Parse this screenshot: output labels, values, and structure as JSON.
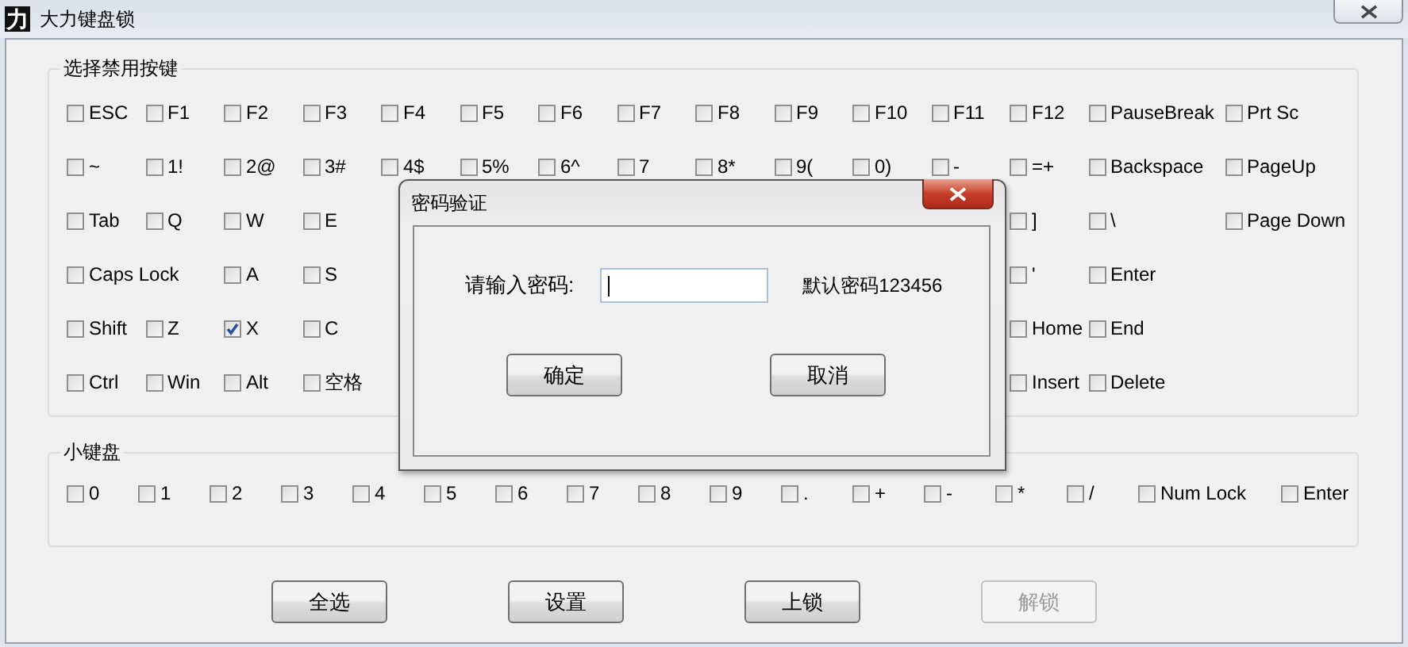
{
  "window": {
    "logo": "力",
    "title": "大力键盘锁"
  },
  "key_group": {
    "title": "选择禁用按键",
    "rows": [
      {
        "left": [
          {
            "label": "ESC",
            "checked": false
          },
          {
            "label": "F1",
            "checked": false
          },
          {
            "label": "F2",
            "checked": false
          },
          {
            "label": "F3",
            "checked": false
          },
          {
            "label": "F4",
            "checked": false
          },
          {
            "label": "F5",
            "checked": false
          },
          {
            "label": "F6",
            "checked": false
          },
          {
            "label": "F7",
            "checked": false
          },
          {
            "label": "F8",
            "checked": false
          },
          {
            "label": "F9",
            "checked": false
          },
          {
            "label": "F10",
            "checked": false
          },
          {
            "label": "F11",
            "checked": false
          },
          {
            "label": "F12",
            "checked": false
          },
          {
            "label": "PauseBreak",
            "checked": false
          }
        ],
        "right": [],
        "end": {
          "label": "Prt Sc",
          "checked": false
        }
      },
      {
        "left": [
          {
            "label": "~",
            "checked": false
          },
          {
            "label": "1!",
            "checked": false
          },
          {
            "label": "2@",
            "checked": false
          },
          {
            "label": "3#",
            "checked": false
          },
          {
            "label": "4$",
            "checked": false
          },
          {
            "label": "5%",
            "checked": false
          },
          {
            "label": "6^",
            "checked": false
          },
          {
            "label": "7",
            "checked": false
          },
          {
            "label": "8*",
            "checked": false
          },
          {
            "label": "9(",
            "checked": false
          },
          {
            "label": "0)",
            "checked": false
          },
          {
            "label": "-",
            "checked": false
          },
          {
            "label": "=+",
            "checked": false
          },
          {
            "label": "Backspace",
            "checked": false
          }
        ],
        "right": [],
        "end": {
          "label": "PageUp",
          "checked": false
        }
      },
      {
        "left": [
          {
            "label": "Tab",
            "checked": false
          },
          {
            "label": "Q",
            "checked": false
          },
          {
            "label": "W",
            "checked": false
          },
          {
            "label": "E",
            "checked": false
          }
        ],
        "right": [
          {
            "label": "]",
            "checked": false
          },
          {
            "label": "\\",
            "checked": false
          }
        ],
        "end": {
          "label": "Page Down",
          "checked": false
        }
      },
      {
        "left": [
          {
            "label": "Caps Lock",
            "checked": false
          },
          {
            "label": "A",
            "checked": false
          },
          {
            "label": "S",
            "checked": false
          }
        ],
        "right": [
          {
            "label": "'",
            "checked": false
          },
          {
            "label": "Enter",
            "checked": false
          }
        ]
      },
      {
        "left": [
          {
            "label": "Shift",
            "checked": false
          },
          {
            "label": "Z",
            "checked": false
          },
          {
            "label": "X",
            "checked": true
          },
          {
            "label": "C",
            "checked": false
          }
        ],
        "right": [
          {
            "label": "Home",
            "checked": false
          },
          {
            "label": "End",
            "checked": false
          }
        ]
      },
      {
        "left": [
          {
            "label": "Ctrl",
            "checked": false
          },
          {
            "label": "Win",
            "checked": false
          },
          {
            "label": "Alt",
            "checked": false
          },
          {
            "label": "空格",
            "checked": false
          }
        ],
        "right": [
          {
            "label": "Insert",
            "checked": false
          },
          {
            "label": "Delete",
            "checked": false
          }
        ]
      }
    ]
  },
  "numpad_group": {
    "title": "小键盘",
    "keys": [
      {
        "label": "0",
        "checked": false
      },
      {
        "label": "1",
        "checked": false
      },
      {
        "label": "2",
        "checked": false
      },
      {
        "label": "3",
        "checked": false
      },
      {
        "label": "4",
        "checked": false
      },
      {
        "label": "5",
        "checked": false
      },
      {
        "label": "6",
        "checked": false
      },
      {
        "label": "7",
        "checked": false
      },
      {
        "label": "8",
        "checked": false
      },
      {
        "label": "9",
        "checked": false
      },
      {
        "label": ".",
        "checked": false
      },
      {
        "label": "+",
        "checked": false
      },
      {
        "label": "-",
        "checked": false
      },
      {
        "label": "*",
        "checked": false
      },
      {
        "label": "/",
        "checked": false
      },
      {
        "label": "Num Lock",
        "checked": false
      },
      {
        "label": "Enter",
        "checked": false
      }
    ]
  },
  "buttons": [
    {
      "label": "全选",
      "disabled": false
    },
    {
      "label": "设置",
      "disabled": false
    },
    {
      "label": "上锁",
      "disabled": false
    },
    {
      "label": "解锁",
      "disabled": true
    }
  ],
  "dialog": {
    "title": "密码验证",
    "prompt": "请输入密码:",
    "password_field": {
      "focused": true
    },
    "hint": "默认密码123456",
    "buttons": [
      {
        "label": "确定"
      },
      {
        "label": "取消"
      }
    ]
  }
}
